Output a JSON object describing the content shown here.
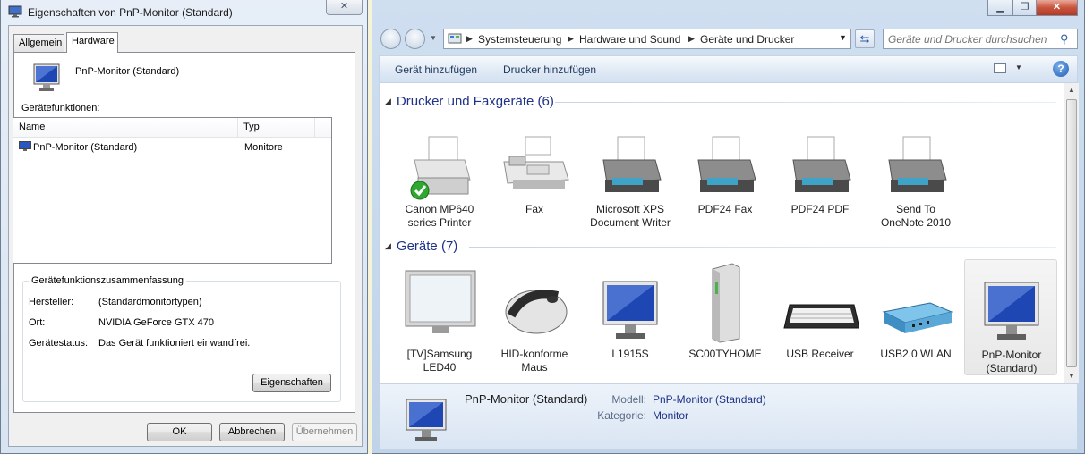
{
  "dialog": {
    "title": "Eigenschaften von PnP-Monitor (Standard)",
    "close_glyph": "✕",
    "tabs": [
      {
        "label": "Allgemein"
      },
      {
        "label": "Hardware"
      }
    ],
    "device_name": "PnP-Monitor (Standard)",
    "functions_label": "Gerätefunktionen:",
    "columns": [
      "Name",
      "Typ"
    ],
    "rows": [
      {
        "name": "PnP-Monitor (Standard)",
        "type": "Monitore"
      }
    ],
    "summary_title": "Gerätefunktionszusammenfassung",
    "summary": [
      {
        "key": "Hersteller:",
        "value": "(Standardmonitortypen)"
      },
      {
        "key": "Ort:",
        "value": "NVIDIA GeForce GTX 470"
      },
      {
        "key": "Gerätestatus:",
        "value": "Das Gerät funktioniert einwandfrei."
      }
    ],
    "properties_button": "Eigenschaften",
    "ok_button": "OK",
    "cancel_button": "Abbrechen",
    "apply_button": "Übernehmen"
  },
  "explorer": {
    "caption": {
      "minimize": "▁",
      "maximize": "❐",
      "close": "✕"
    },
    "breadcrumb": [
      "Systemsteuerung",
      "Hardware und Sound",
      "Geräte und Drucker"
    ],
    "search_placeholder": "Geräte und Drucker durchsuchen",
    "commands": [
      "Gerät hinzufügen",
      "Drucker hinzufügen"
    ],
    "help_glyph": "?",
    "printers_group": "Drucker und Faxgeräte (6)",
    "printers": [
      {
        "line1": "Canon MP640",
        "line2": "series Printer",
        "icon": "printer-default-icon"
      },
      {
        "line1": "Fax",
        "line2": "",
        "icon": "fax-icon"
      },
      {
        "line1": "Microsoft XPS",
        "line2": "Document Writer",
        "icon": "printer-icon"
      },
      {
        "line1": "PDF24 Fax",
        "line2": "",
        "icon": "printer-icon"
      },
      {
        "line1": "PDF24 PDF",
        "line2": "",
        "icon": "printer-icon"
      },
      {
        "line1": "Send To",
        "line2": "OneNote 2010",
        "icon": "printer-icon"
      }
    ],
    "devices_group": "Geräte (7)",
    "devices": [
      {
        "line1": "[TV]Samsung",
        "line2": "LED40",
        "icon": "tv-icon"
      },
      {
        "line1": "HID-konforme",
        "line2": "Maus",
        "icon": "mouse-icon"
      },
      {
        "line1": "L1915S",
        "line2": "",
        "icon": "monitor-icon"
      },
      {
        "line1": "SC00TYHOME",
        "line2": "",
        "icon": "computer-tower-icon"
      },
      {
        "line1": "USB Receiver",
        "line2": "",
        "icon": "keyboard-icon"
      },
      {
        "line1": "USB2.0 WLAN",
        "line2": "",
        "icon": "wlan-adapter-icon"
      },
      {
        "line1": "PnP-Monitor",
        "line2": "(Standard)",
        "icon": "monitor-icon"
      }
    ],
    "details": {
      "name": "PnP-Monitor (Standard)",
      "model_label": "Modell:",
      "model_value": "PnP-Monitor (Standard)",
      "category_label": "Kategorie:",
      "category_value": "Monitor"
    }
  }
}
